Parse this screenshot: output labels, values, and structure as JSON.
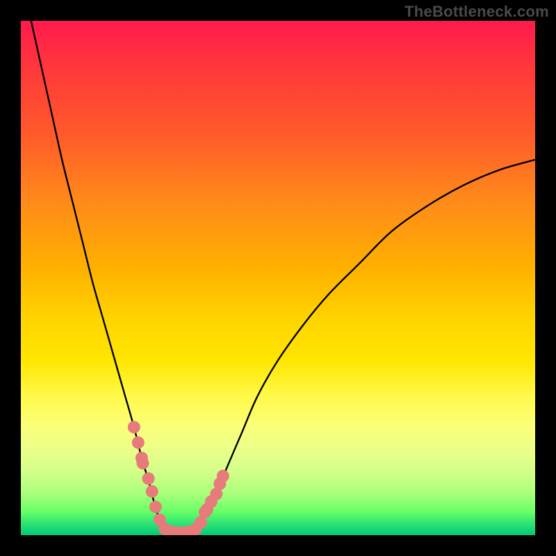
{
  "attribution": "TheBottleneck.com",
  "chart_data": {
    "type": "line",
    "title": "",
    "xlabel": "",
    "ylabel": "",
    "xlim": [
      0,
      100
    ],
    "ylim": [
      0,
      100
    ],
    "series": [
      {
        "name": "left-arm",
        "x": [
          2,
          4,
          6,
          8,
          10,
          12,
          14,
          16,
          18,
          20,
          22,
          23.5,
          25,
          26,
          27,
          28
        ],
        "y": [
          100,
          91,
          82,
          73,
          65,
          57,
          49,
          42,
          35,
          28,
          21,
          15,
          10,
          6,
          3,
          1
        ]
      },
      {
        "name": "trough",
        "x": [
          28,
          29,
          30,
          31,
          32,
          33,
          34
        ],
        "y": [
          1,
          0.5,
          0.5,
          0.5,
          0.5,
          0.7,
          1.2
        ]
      },
      {
        "name": "right-arm",
        "x": [
          34,
          36,
          38,
          40,
          43,
          46,
          50,
          55,
          60,
          66,
          72,
          79,
          86,
          93,
          100
        ],
        "y": [
          1.2,
          4,
          8,
          13,
          20,
          27,
          34,
          41,
          47,
          53,
          59,
          64,
          68,
          71,
          73
        ]
      }
    ],
    "markers": {
      "name": "marker-points",
      "x": [
        22.0,
        22.8,
        23.5,
        23.7,
        24.8,
        25.5,
        26.2,
        27.0,
        28.0,
        29.0,
        30.0,
        31.0,
        32.0,
        33.0,
        34.0,
        35.0,
        35.8,
        36.2,
        37.0,
        38.0,
        38.7,
        39.3
      ],
      "y": [
        21.0,
        18.0,
        15.0,
        14.0,
        11.0,
        8.5,
        5.5,
        3.0,
        1.2,
        0.7,
        0.5,
        0.5,
        0.5,
        0.7,
        1.2,
        2.5,
        4.5,
        5.0,
        6.5,
        8.0,
        10.0,
        11.5
      ],
      "color": "#e77a7a",
      "radius": 9
    },
    "curve_color": "#000000",
    "curve_width": 2.4
  }
}
